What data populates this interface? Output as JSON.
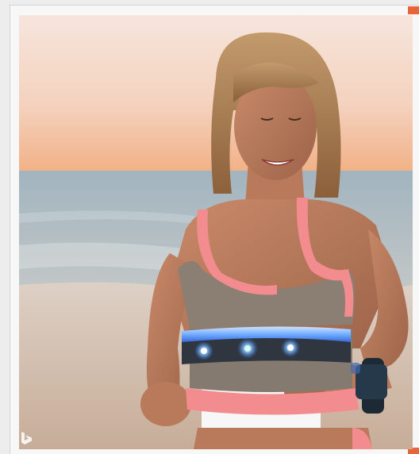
{
  "image": {
    "subject": "woman-running-on-beach-with-led-chest-strap-and-smartwatch",
    "logo": "b"
  },
  "colors": {
    "accent": "#e8643a",
    "frame_bg": "#f7f7f7",
    "page_bg": "#ededed",
    "sky_top": "#f4ddd2",
    "sky_horizon": "#f2b98c",
    "sea": "#8fa7b4",
    "sand": "#d8c3b1",
    "top_gray": "#8b7e73",
    "top_pink": "#f28c8f",
    "led_blue": "#5fa8ff",
    "watch": "#1d2a36"
  },
  "icons": {
    "watermark": "bing-b-icon"
  }
}
